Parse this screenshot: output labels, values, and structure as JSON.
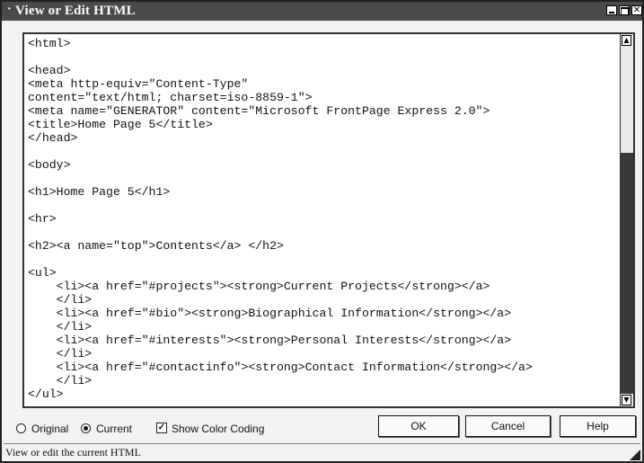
{
  "window": {
    "title": "View or Edit HTML",
    "sys_glyph": "·",
    "close_glyph": "✕"
  },
  "editor": {
    "lines": [
      "<html>",
      "",
      "<head>",
      "<meta http-equiv=\"Content-Type\"",
      "content=\"text/html; charset=iso-8859-1\">",
      "<meta name=\"GENERATOR\" content=\"Microsoft FrontPage Express 2.0\">",
      "<title>Home Page 5</title>",
      "</head>",
      "",
      "<body>",
      "",
      "<h1>Home Page 5</h1>",
      "",
      "<hr>",
      "",
      "<h2><a name=\"top\">Contents</a> </h2>",
      "",
      "<ul>",
      "    <li><a href=\"#projects\"><strong>Current Projects</strong></a>",
      "    </li>",
      "    <li><a href=\"#bio\"><strong>Biographical Information</strong></a>",
      "    </li>",
      "    <li><a href=\"#interests\"><strong>Personal Interests</strong></a>",
      "    </li>",
      "    <li><a href=\"#contactinfo\"><strong>Contact Information</strong></a>",
      "    </li>",
      "</ul>"
    ],
    "scroll_up_glyph": "▲",
    "scroll_down_glyph": "▼"
  },
  "options": {
    "original_label": "Original",
    "current_label": "Current",
    "show_color_coding_label": "Show Color Coding",
    "selected_view": "Current",
    "show_color_coding_checked": true,
    "check_glyph": "✓"
  },
  "buttons": {
    "ok": "OK",
    "cancel": "Cancel",
    "help": "Help"
  },
  "status": {
    "text": "View or edit the current HTML"
  },
  "icons": {
    "minimize": "minimize-icon",
    "maximize": "maximize-icon",
    "close": "close-icon",
    "scroll_up": "scroll-up-arrow-icon",
    "scroll_down": "scroll-down-arrow-icon",
    "resize_grip": "resize-grip-icon"
  }
}
